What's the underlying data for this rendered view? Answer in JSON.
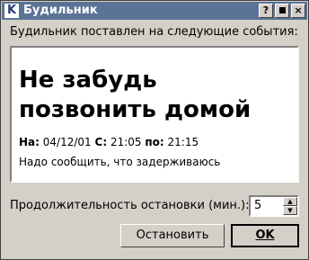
{
  "window": {
    "title": "Будильник",
    "icon_letter": "K",
    "buttons": {
      "help": "?",
      "close": "×"
    }
  },
  "header_label": "Будильник поставлен на следующие события:",
  "message": {
    "title": "Не забудь позвонить домой",
    "date_label": "На:",
    "date": "04/12/01",
    "from_label": "С:",
    "from": "21:05",
    "to_label": "по:",
    "to": "21:15",
    "description": "Надо сообщить, что задерживаюсь"
  },
  "duration": {
    "label": "Продолжительность остановки (мин.):",
    "value": "5"
  },
  "actions": {
    "stop": "Остановить",
    "ok": "OK"
  }
}
